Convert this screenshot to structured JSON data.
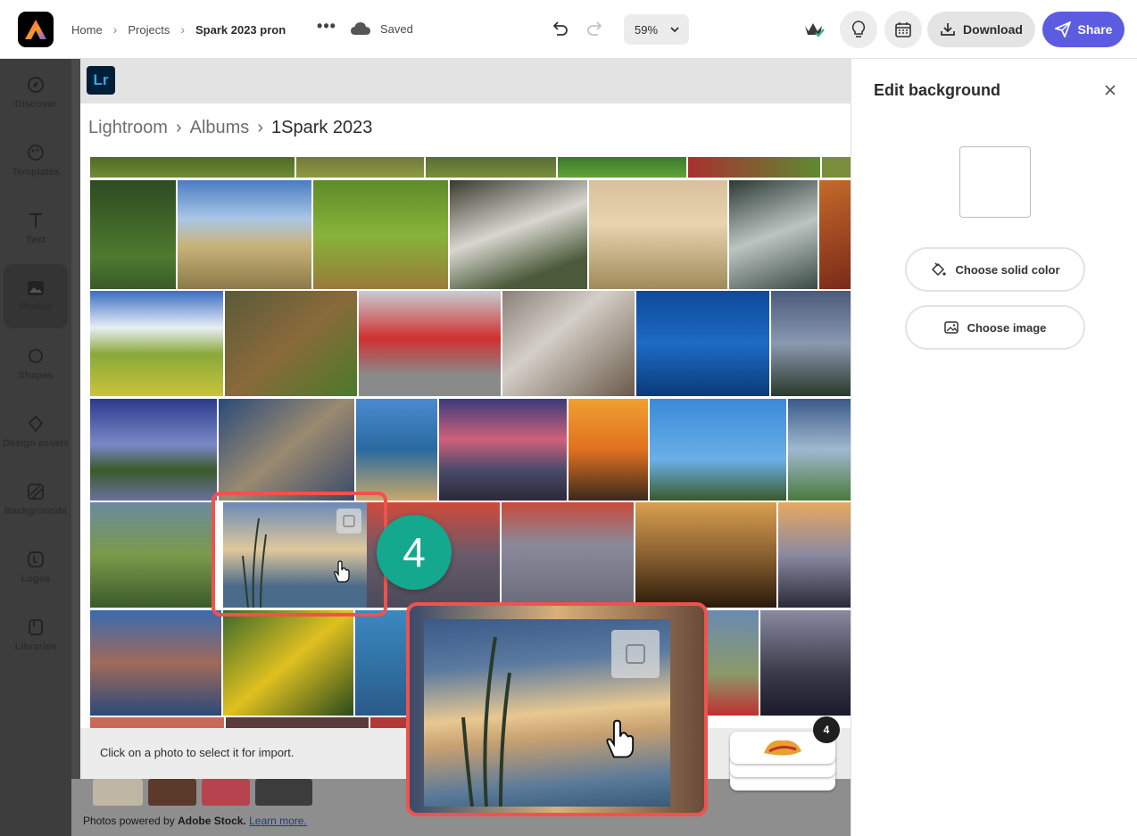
{
  "topbar": {
    "breadcrumb": [
      "Home",
      "Projects",
      "Spark 2023 pron"
    ],
    "more_label": "•••",
    "saved_label": "Saved",
    "zoom_value": "59%",
    "download_label": "Download",
    "share_label": "Share"
  },
  "sidebar": {
    "items": [
      {
        "label": "Discover",
        "icon": "discover-icon"
      },
      {
        "label": "Templates",
        "icon": "templates-icon"
      },
      {
        "label": "Text",
        "icon": "text-icon"
      },
      {
        "label": "Photos",
        "icon": "photos-icon"
      },
      {
        "label": "Shapes",
        "icon": "shapes-icon"
      },
      {
        "label": "Design assets",
        "icon": "design-assets-icon"
      },
      {
        "label": "Backgrounds",
        "icon": "backgrounds-icon"
      },
      {
        "label": "Logos",
        "icon": "logos-icon"
      },
      {
        "label": "Libraries",
        "icon": "libraries-icon"
      }
    ]
  },
  "dialog": {
    "app_badge": "Lr",
    "breadcrumb": [
      "Lightroom",
      "Albums",
      "1Spark 2023"
    ],
    "footer_hint": "Click on a photo to select it for import."
  },
  "annotation": {
    "step_number": "4",
    "stack_count": "4"
  },
  "below": {
    "powered_prefix": "Photos powered by",
    "powered_brand": "Adobe Stock.",
    "powered_link": "Learn more."
  },
  "right_panel": {
    "title": "Edit background",
    "solid_color_label": "Choose solid color",
    "image_label": "Choose image"
  },
  "colors": {
    "accent": "#5c5ce0",
    "highlight": "#f0524d",
    "step": "#14a88e"
  }
}
